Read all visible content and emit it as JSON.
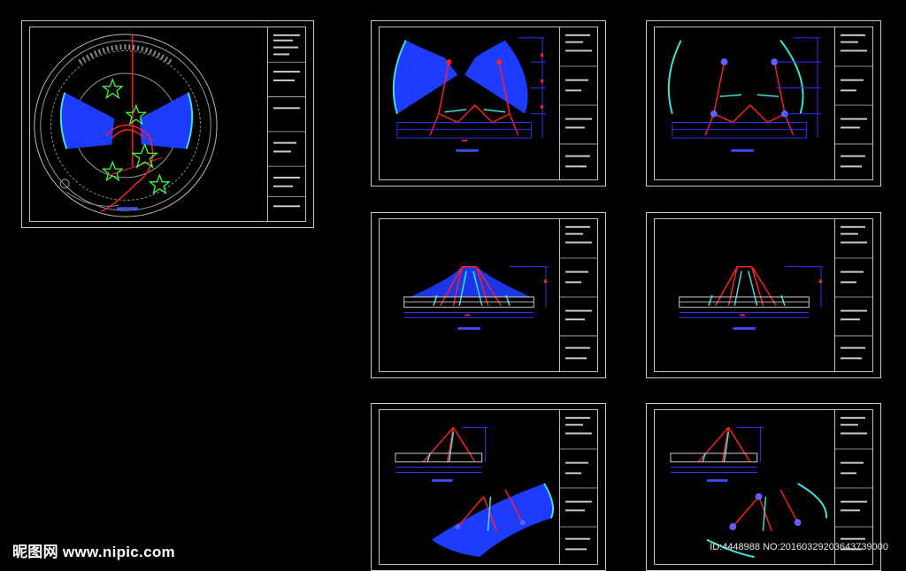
{
  "watermark": {
    "brand": "昵图网 www.nipic.com",
    "id_text": "ID:4448988 NO:20160329203643739000"
  },
  "colors": {
    "background": "#000000",
    "frame": "#c8c8c8",
    "fill_blue": "#1e3cff",
    "line_red": "#ff2020",
    "line_cyan": "#3fe3e3",
    "line_green": "#40ff40",
    "dim_blue": "#3030ff",
    "title_bar": "#3a4dff"
  },
  "sheets": [
    {
      "id": "plan-sheet",
      "kind": "plan"
    },
    {
      "id": "elevation-sheet-1",
      "kind": "front-fill"
    },
    {
      "id": "elevation-sheet-2",
      "kind": "front-outline"
    },
    {
      "id": "section-sheet-1",
      "kind": "section"
    },
    {
      "id": "section-sheet-2",
      "kind": "section"
    },
    {
      "id": "side-sheet-1",
      "kind": "side-fill"
    },
    {
      "id": "side-sheet-2",
      "kind": "side-outline"
    }
  ]
}
